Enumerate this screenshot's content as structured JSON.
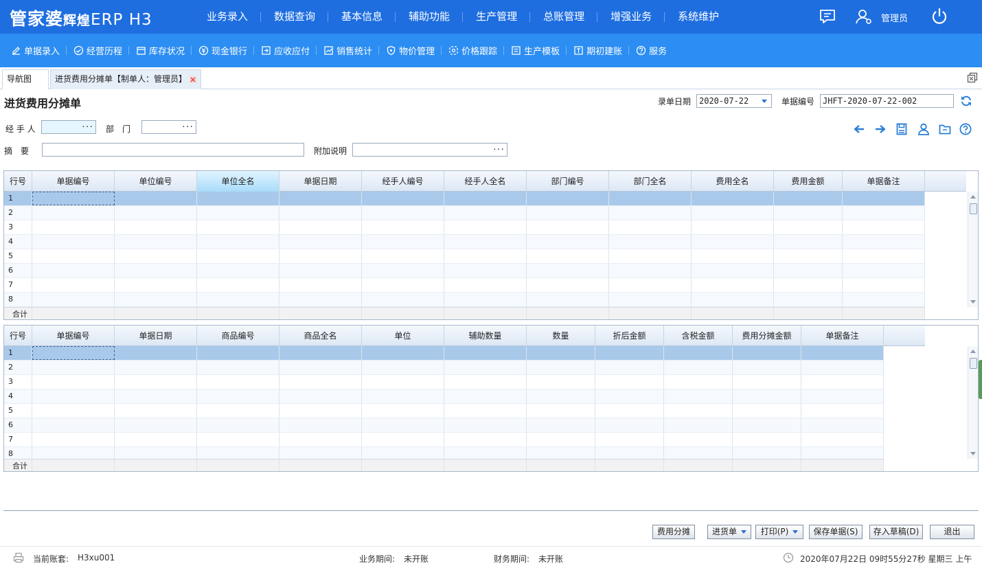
{
  "app": {
    "logo_main": "管家婆",
    "logo_sub": "辉煌",
    "logo_ver": "ERP H3",
    "user_name": "管理员"
  },
  "main_nav": [
    "业务录入",
    "数据查询",
    "基本信息",
    "辅助功能",
    "生产管理",
    "总账管理",
    "增强业务",
    "系统维护"
  ],
  "toolbar": [
    {
      "label": "单据录入",
      "icon": "edit-icon"
    },
    {
      "label": "经营历程",
      "icon": "history-icon"
    },
    {
      "label": "库存状况",
      "icon": "inventory-icon"
    },
    {
      "label": "现金银行",
      "icon": "cash-icon"
    },
    {
      "label": "应收应付",
      "icon": "receivable-icon"
    },
    {
      "label": "销售统计",
      "icon": "sales-stats-icon"
    },
    {
      "label": "物价管理",
      "icon": "price-icon"
    },
    {
      "label": "价格跟踪",
      "icon": "price-track-icon"
    },
    {
      "label": "生产模板",
      "icon": "template-icon"
    },
    {
      "label": "期初建账",
      "icon": "opening-account-icon"
    },
    {
      "label": "服务",
      "icon": "help-icon"
    }
  ],
  "tabs": {
    "nav": "导航图",
    "doc": "进货费用分摊单【制单人：管理员】"
  },
  "form": {
    "title": "进货费用分摊单",
    "date_label": "录单日期",
    "date_value": "2020-07-22",
    "docno_label": "单据编号",
    "docno_value": "JHFT-2020-07-22-002",
    "handler_label": "经 手 人",
    "dept_label": "部　门",
    "summary_label": "摘　要",
    "extra_label": "附加说明",
    "dots": "···"
  },
  "grid1": {
    "headers": [
      "行号",
      "单据编号",
      "单位编号",
      "单位全名",
      "单据日期",
      "经手人编号",
      "经手人全名",
      "部门编号",
      "部门全名",
      "费用全名",
      "费用金额",
      "单据备注"
    ],
    "rows": [
      "1",
      "2",
      "3",
      "4",
      "5",
      "6",
      "7",
      "8"
    ],
    "total_label": "合计"
  },
  "grid2": {
    "headers": [
      "行号",
      "单据编号",
      "单据日期",
      "商品编号",
      "商品全名",
      "单位",
      "辅助数量",
      "数量",
      "折后金额",
      "含税金额",
      "费用分摊金额",
      "单据备注"
    ],
    "rows": [
      "1",
      "2",
      "3",
      "4",
      "5",
      "6",
      "7",
      "8"
    ],
    "total_label": "合计"
  },
  "buttons": {
    "allocate": "费用分摊",
    "purchase": "进货单",
    "print": "打印(P)",
    "save": "保存单据(S)",
    "draft": "存入草稿(D)",
    "exit": "退出"
  },
  "status": {
    "account_label": "当前账套:",
    "account_value": "H3xu001",
    "biz_period_label": "业务期间:",
    "biz_period_value": "未开账",
    "fin_period_label": "财务期间:",
    "fin_period_value": "未开账",
    "datetime": "2020年07月22日 09时55分27秒 星期三 上午"
  },
  "colors": {
    "topbar": "#1e6ee0",
    "toolbar": "#2c8df2",
    "selected_row": "#a9c9ea",
    "icon_blue": "#2a7fd6"
  }
}
